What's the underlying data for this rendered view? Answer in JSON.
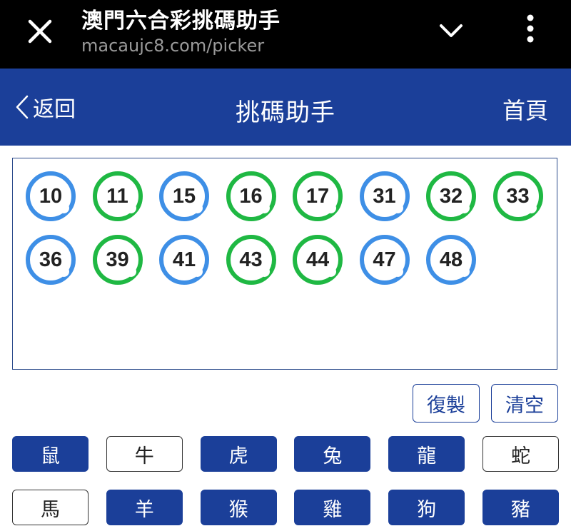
{
  "browser": {
    "page_title": "澳門六合彩挑碼助手",
    "url": "macaujc8.com/picker",
    "icons": [
      "close-icon",
      "chevron-down-icon",
      "more-vert-icon"
    ]
  },
  "header": {
    "back_label": "返回",
    "title": "挑碼助手",
    "home_label": "首頁",
    "bg_color": "#1b3f99"
  },
  "numbers": [
    {
      "value": "10",
      "color": "blue"
    },
    {
      "value": "11",
      "color": "green"
    },
    {
      "value": "15",
      "color": "blue"
    },
    {
      "value": "16",
      "color": "green"
    },
    {
      "value": "17",
      "color": "green"
    },
    {
      "value": "31",
      "color": "blue"
    },
    {
      "value": "32",
      "color": "green"
    },
    {
      "value": "33",
      "color": "green"
    },
    {
      "value": "36",
      "color": "blue"
    },
    {
      "value": "39",
      "color": "green"
    },
    {
      "value": "41",
      "color": "blue"
    },
    {
      "value": "43",
      "color": "green"
    },
    {
      "value": "44",
      "color": "green"
    },
    {
      "value": "47",
      "color": "blue"
    },
    {
      "value": "48",
      "color": "blue"
    }
  ],
  "ball_colors": {
    "blue": "#3e8fe6",
    "green": "#1fb843"
  },
  "actions": {
    "copy_label": "復製",
    "clear_label": "清空"
  },
  "zodiac": [
    {
      "label": "鼠",
      "selected": true
    },
    {
      "label": "牛",
      "selected": false
    },
    {
      "label": "虎",
      "selected": true
    },
    {
      "label": "兔",
      "selected": true
    },
    {
      "label": "龍",
      "selected": true
    },
    {
      "label": "蛇",
      "selected": false
    },
    {
      "label": "馬",
      "selected": false
    },
    {
      "label": "羊",
      "selected": true
    },
    {
      "label": "猴",
      "selected": true
    },
    {
      "label": "雞",
      "selected": true
    },
    {
      "label": "狗",
      "selected": true
    },
    {
      "label": "豬",
      "selected": true
    }
  ]
}
